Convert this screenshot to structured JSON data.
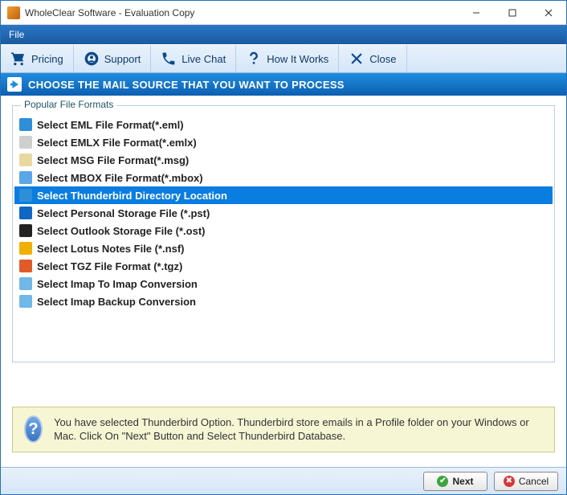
{
  "window": {
    "title": "WholeClear Software - Evaluation Copy"
  },
  "menubar": {
    "file": "File"
  },
  "toolbar": {
    "pricing": "Pricing",
    "support": "Support",
    "livechat": "Live Chat",
    "howitworks": "How It Works",
    "close": "Close"
  },
  "banner": {
    "text": "CHOOSE THE MAIL SOURCE THAT YOU WANT TO PROCESS"
  },
  "group": {
    "legend": "Popular File Formats"
  },
  "formats": [
    {
      "label": "Select EML File Format(*.eml)",
      "icon_bg": "#2e8fd8",
      "selected": false
    },
    {
      "label": "Select EMLX File Format(*.emlx)",
      "icon_bg": "#cfcfcf",
      "selected": false
    },
    {
      "label": "Select MSG File Format(*.msg)",
      "icon_bg": "#e8d8a0",
      "selected": false
    },
    {
      "label": "Select MBOX File Format(*.mbox)",
      "icon_bg": "#5aa6e6",
      "selected": false
    },
    {
      "label": "Select Thunderbird Directory Location",
      "icon_bg": "#2e8fd8",
      "selected": true
    },
    {
      "label": "Select Personal Storage File (*.pst)",
      "icon_bg": "#1066c4",
      "selected": false
    },
    {
      "label": "Select Outlook Storage File (*.ost)",
      "icon_bg": "#222222",
      "selected": false
    },
    {
      "label": "Select Lotus Notes File (*.nsf)",
      "icon_bg": "#f0b000",
      "selected": false
    },
    {
      "label": "Select TGZ File Format (*.tgz)",
      "icon_bg": "#e05a2a",
      "selected": false
    },
    {
      "label": "Select Imap To Imap Conversion",
      "icon_bg": "#6fb8e8",
      "selected": false
    },
    {
      "label": "Select Imap Backup Conversion",
      "icon_bg": "#6fb8e8",
      "selected": false
    }
  ],
  "info": {
    "text": "You have selected Thunderbird Option. Thunderbird store emails in a Profile folder on your Windows or Mac. Click On \"Next\" Button and Select Thunderbird Database."
  },
  "footer": {
    "next": "Next",
    "cancel": "Cancel"
  }
}
